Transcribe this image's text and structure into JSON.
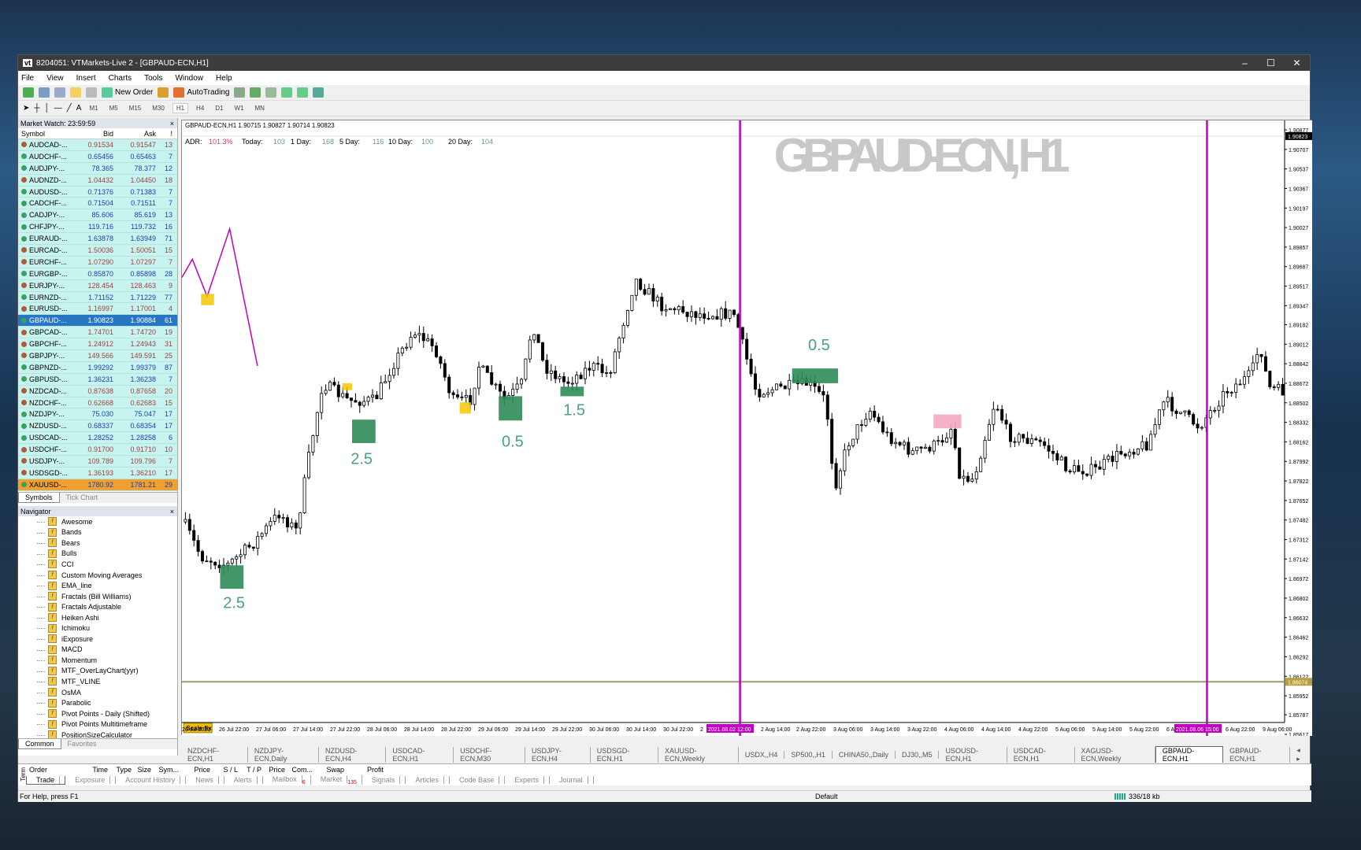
{
  "window": {
    "title": "8204051: VTMarkets-Live 2 - [GBPAUD-ECN,H1]",
    "logo": "vt"
  },
  "menu": [
    "File",
    "View",
    "Insert",
    "Charts",
    "Tools",
    "Window",
    "Help"
  ],
  "toolbar": {
    "new_order": "New Order",
    "autotrading": "AutoTrading",
    "timeframes": [
      "M1",
      "M5",
      "M15",
      "M30",
      "H1",
      "H4",
      "D1",
      "W1",
      "MN"
    ],
    "active_tf": "H1"
  },
  "market_watch": {
    "title": "Market Watch: 23:59:59",
    "columns": [
      "Symbol",
      "Bid",
      "Ask",
      "!"
    ],
    "rows": [
      [
        "AUDCAD-...",
        "0.91534",
        "0.91547",
        "13",
        "dn"
      ],
      [
        "AUDCHF-...",
        "0.65456",
        "0.65463",
        "7",
        "up"
      ],
      [
        "AUDJPY-...",
        "78.365",
        "78.377",
        "12",
        "up"
      ],
      [
        "AUDNZD-...",
        "1.04432",
        "1.04450",
        "18",
        "dn"
      ],
      [
        "AUDUSD-...",
        "0.71376",
        "0.71383",
        "7",
        "up"
      ],
      [
        "CADCHF-...",
        "0.71504",
        "0.71511",
        "7",
        "up"
      ],
      [
        "CADJPY-...",
        "85.606",
        "85.619",
        "13",
        "up"
      ],
      [
        "CHFJPY-...",
        "119.716",
        "119.732",
        "16",
        "up"
      ],
      [
        "EURAUD-...",
        "1.63878",
        "1.63949",
        "71",
        "up"
      ],
      [
        "EURCAD-...",
        "1.50036",
        "1.50051",
        "15",
        "dn"
      ],
      [
        "EURCHF-...",
        "1.07290",
        "1.07297",
        "7",
        "dn"
      ],
      [
        "EURGBP-...",
        "0.85870",
        "0.85898",
        "28",
        "up"
      ],
      [
        "EURJPY-...",
        "128.454",
        "128.463",
        "9",
        "dn"
      ],
      [
        "EURNZD-...",
        "1.71152",
        "1.71229",
        "77",
        "up"
      ],
      [
        "EURUSD-...",
        "1.16997",
        "1.17001",
        "4",
        "dn"
      ],
      [
        "GBPAUD-...",
        "1.90823",
        "1.90884",
        "61",
        "sel"
      ],
      [
        "GBPCAD-...",
        "1.74701",
        "1.74720",
        "19",
        "dn"
      ],
      [
        "GBPCHF-...",
        "1.24912",
        "1.24943",
        "31",
        "dn"
      ],
      [
        "GBPJPY-...",
        "149.566",
        "149.591",
        "25",
        "dn"
      ],
      [
        "GBPNZD-...",
        "1.99292",
        "1.99379",
        "87",
        "up"
      ],
      [
        "GBPUSD-...",
        "1.36231",
        "1.36238",
        "7",
        "up"
      ],
      [
        "NZDCAD-...",
        "0.87638",
        "0.87658",
        "20",
        "dn"
      ],
      [
        "NZDCHF-...",
        "0.62668",
        "0.62683",
        "15",
        "dn"
      ],
      [
        "NZDJPY-...",
        "75.030",
        "75.047",
        "17",
        "up"
      ],
      [
        "NZDUSD-...",
        "0.68337",
        "0.68354",
        "17",
        "up"
      ],
      [
        "USDCAD-...",
        "1.28252",
        "1.28258",
        "6",
        "up"
      ],
      [
        "USDCHF-...",
        "0.91700",
        "0.91710",
        "10",
        "dn"
      ],
      [
        "USDJPY-...",
        "109.789",
        "109.796",
        "7",
        "dn"
      ],
      [
        "USDSGD-...",
        "1.36193",
        "1.36210",
        "17",
        "dn"
      ],
      [
        "XAUUSD-...",
        "1780.92",
        "1781.21",
        "29",
        "gold"
      ]
    ],
    "tabs": [
      "Symbols",
      "Tick Chart"
    ]
  },
  "navigator": {
    "title": "Navigator",
    "items": [
      "Awesome",
      "Bands",
      "Bears",
      "Bulls",
      "CCI",
      "Custom Moving Averages",
      "EMA_line",
      "Fractals (Bill Williams)",
      "Fractals Adjustable",
      "Heiken Ashi",
      "Ichimoku",
      "iExposure",
      "MACD",
      "Momentum",
      "MTF_OverLayChart(yyr)",
      "MTF_VLINE",
      "OsMA",
      "Parabolic",
      "Pivot Points - Daily (Shifted)",
      "Pivot Points Multitimeframe",
      "PositionSizeCalculator"
    ],
    "tabs": [
      "Common",
      "Favorites"
    ]
  },
  "chart": {
    "header": "GBPAUD-ECN,H1  1.90715 1.90827 1.90714 1.90823",
    "watermark": "GBPAUD-ECN, H1",
    "adr": [
      [
        "ADR:",
        "101.3%",
        "#d04060"
      ],
      [
        "Today:",
        "103",
        "#6a9a80"
      ],
      [
        "1 Day:",
        "168",
        "#6a9a80"
      ],
      [
        "5 Day:",
        "116",
        "#6a9a80"
      ],
      [
        "10 Day:",
        "100",
        "#6a9a80"
      ],
      [
        "20 Day:",
        "104",
        "#6a9a80"
      ]
    ],
    "price_ticks": [
      "1.90877",
      "1.90707",
      "1.90537",
      "1.90367",
      "1.90197",
      "1.90027",
      "1.89857",
      "1.89687",
      "1.89517",
      "1.89347",
      "1.89182",
      "1.89012",
      "1.88842",
      "1.88672",
      "1.88502",
      "1.88332",
      "1.88162",
      "1.87992",
      "1.87822",
      "1.87652",
      "1.87482",
      "1.87312",
      "1.87142",
      "1.86972",
      "1.86802",
      "1.86632",
      "1.86462",
      "1.86292",
      "1.86122",
      "1.85952",
      "1.85787",
      "1.85617"
    ],
    "current_price": "1.90823",
    "hline_price": "1.86074",
    "time_ticks": [
      "26 Jul 2021",
      "26 Jul 22:00",
      "27 Jul 06:00",
      "27 Jul 14:00",
      "27 Jul 22:00",
      "28 Jul 06:00",
      "28 Jul 14:00",
      "28 Jul 22:00",
      "29 Jul 06:00",
      "29 Jul 14:00",
      "29 Jul 22:00",
      "30 Jul 06:00",
      "30 Jul 14:00",
      "30 Jul 22:00",
      "2",
      "2021.08.02 12:00",
      "2 Aug 14:00",
      "2 Aug 22:00",
      "3 Aug 06:00",
      "3 Aug 14:00",
      "3 Aug 22:00",
      "4 Aug 06:00",
      "4 Aug 14:00",
      "4 Aug 22:00",
      "5 Aug 06:00",
      "5 Aug 14:00",
      "5 Aug 22:00",
      "6 Aug 0",
      "2021.08.06 15:00",
      "6 Aug 22:00",
      "9 Aug 06:00"
    ],
    "vline_labels": [
      "2021.08.02 12:00",
      "2021.08.06 15:00"
    ],
    "labels": [
      "2.5",
      "2.5",
      "0.5",
      "1.5",
      "0.5"
    ],
    "scale_fix": "Scale fix",
    "colors": {
      "vline": "#c000c0",
      "hline": "#a09a70",
      "box": "#2e8b57",
      "label": "#4aa37a",
      "marker": "#f5c800",
      "pink": "#f4a8c0"
    }
  },
  "chart_tabs": [
    "NZDCHF-ECN,H1",
    "NZDJPY-ECN,Daily",
    "NZDUSD-ECN,H4",
    "USDCAD-ECN,H1",
    "USDCHF-ECN,M30",
    "USDJPY-ECN,H4",
    "USDSGD-ECN,H1",
    "XAUUSD-ECN,Weekly",
    "USDX,,H4",
    "SP500,,H1",
    "CHINA50,,Daily",
    "DJ30,,M5",
    "USOUSD-ECN,H1",
    "USDCAD-ECN,H1",
    "XAGUSD-ECN,Weekly",
    "GBPAUD-ECN,H1",
    "GBPAUD-ECN,H1"
  ],
  "chart_tab_active": 15,
  "terminal": {
    "side": "Term",
    "columns": [
      "Order",
      "Time",
      "Type",
      "Size",
      "Sym...",
      "Price",
      "S / L",
      "T / P",
      "Price",
      "Com...",
      "Swap",
      "Profit"
    ],
    "tabs": [
      "Trade",
      "Exposure",
      "Account History",
      "News",
      "Alerts",
      "Mailbox",
      "Market",
      "Signals",
      "Articles",
      "Code Base",
      "Experts",
      "Journal"
    ],
    "badges": {
      "Mailbox": "6",
      "Market": "135"
    }
  },
  "status": {
    "help": "For Help, press F1",
    "profile": "Default",
    "traffic": "336/18 kb"
  }
}
